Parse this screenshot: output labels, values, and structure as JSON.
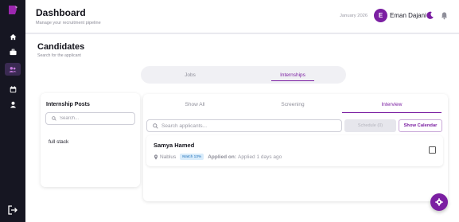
{
  "header": {
    "title": "Dashboard",
    "subtitle": "Manage your recruitment pipeline",
    "date": "January 2026",
    "avatar_initial": "E",
    "user_name": "Eman Dajani"
  },
  "sidebar": {
    "items": [
      {
        "icon": "home-icon"
      },
      {
        "icon": "briefcase-icon"
      },
      {
        "icon": "users-icon",
        "active": true
      },
      {
        "icon": "calendar-icon"
      },
      {
        "icon": "person-icon"
      }
    ],
    "bottom_icon": "logout-icon"
  },
  "page": {
    "title": "Candidates",
    "subtitle": "Search for the applicant"
  },
  "job_tabs": {
    "jobs": "Jobs",
    "internships": "Internships",
    "active": "internships"
  },
  "posts": {
    "title": "Internship Posts",
    "search_placeholder": "Search...",
    "items": [
      "full stack"
    ]
  },
  "status_tabs": {
    "all": "Show All",
    "screening": "Screening",
    "interview": "Interview",
    "active": "interview"
  },
  "candidates": {
    "search_placeholder": "Search applicants...",
    "schedule_label": "Schedule (0)",
    "calendar_label": "Show Calendar",
    "rows": [
      {
        "name": "Samya Hamed",
        "location": "Nablus",
        "match": "Match 13%",
        "applied_label": "Applied on:",
        "applied_value": "Applied 1 days ago",
        "checked": false
      }
    ]
  },
  "colors": {
    "accent": "#7b1fa2",
    "sidebar": "#161622",
    "match_bg": "#d9ecfb",
    "match_text": "#1e6fb8"
  }
}
